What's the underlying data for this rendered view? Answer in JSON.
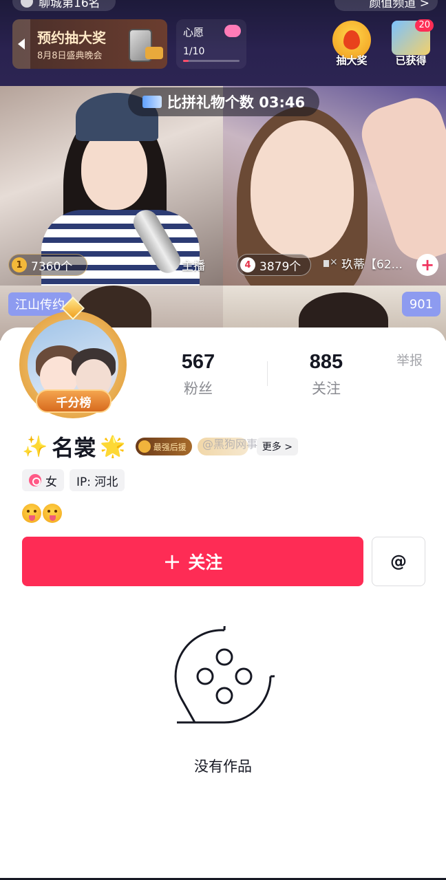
{
  "topbar": {
    "left_pill": "聊城第16名",
    "right_pill": "颜值频道 >",
    "promo_title": "预约抽大奖",
    "promo_subtitle": "8月8日盛典晚会",
    "wish_label": "心愿",
    "wish_count": "1/10",
    "wish_progress": 0.1,
    "draw_label": "抽大奖",
    "got_label": "已获得",
    "got_badge": "20"
  },
  "battle": {
    "title": "比拼礼物个数 03:46",
    "left_rank": "1",
    "left_count": "7360个",
    "left_role": "主播",
    "right_rank": "4",
    "right_count": "3879个",
    "right_name": "玖蒂【62...",
    "left_tag": "江山传约",
    "right_tag": "901"
  },
  "profile": {
    "avatar_ribbon": "千分榜",
    "followers_num": "567",
    "followers_label": "粉丝",
    "following_num": "885",
    "following_label": "关注",
    "report_label": "举报",
    "name_prefix": "✨",
    "name": "名裳",
    "name_suffix": "🌟",
    "rank_badge": "最强后援",
    "more_label": "更多 >",
    "watermark": "@黑狗网事",
    "gender": "女",
    "ip": "IP: 河北",
    "follow_plus": "+",
    "follow_label": "关注",
    "at_label": "@",
    "empty_text": "没有作品"
  },
  "colors": {
    "primary": "#fe2c55",
    "topbar": "#2a2250",
    "tag_blue": "#8d9bf0"
  }
}
